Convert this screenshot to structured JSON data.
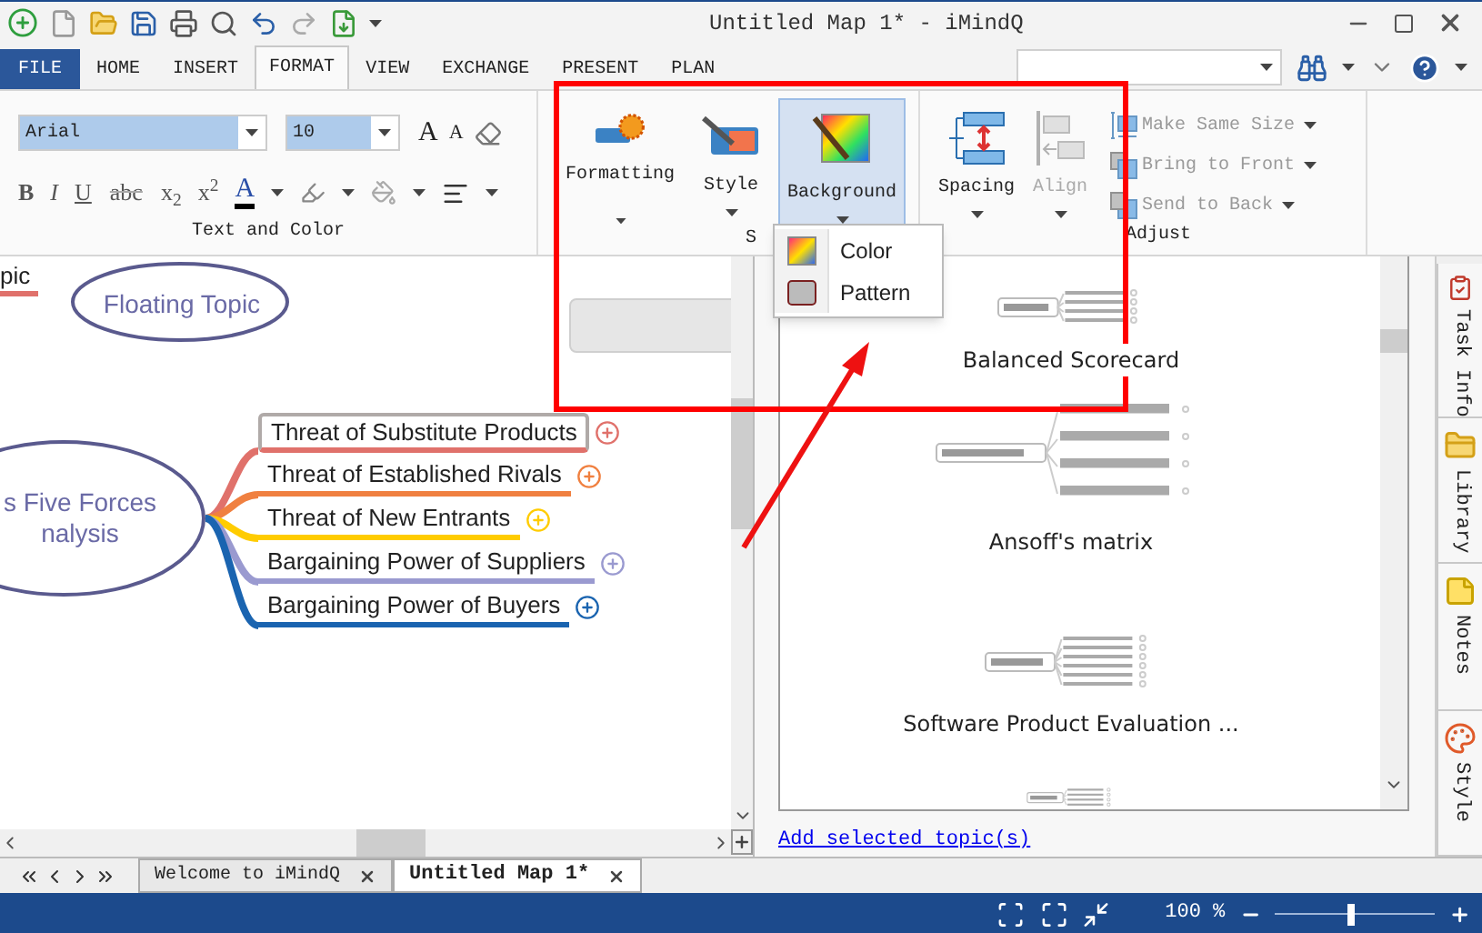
{
  "window": {
    "title": "Untitled Map 1* - iMindQ"
  },
  "ribbon_tabs": [
    {
      "label": "FILE",
      "kind": "file",
      "selected": false
    },
    {
      "label": "HOME",
      "kind": "tab",
      "selected": false
    },
    {
      "label": "INSERT",
      "kind": "tab",
      "selected": false
    },
    {
      "label": "FORMAT",
      "kind": "tab",
      "selected": true
    },
    {
      "label": "VIEW",
      "kind": "tab",
      "selected": false
    },
    {
      "label": "EXCHANGE",
      "kind": "tab",
      "selected": false
    },
    {
      "label": "PRESENT",
      "kind": "tab",
      "selected": false
    },
    {
      "label": "PLAN",
      "kind": "tab",
      "selected": false
    }
  ],
  "text_and_color": {
    "font": {
      "value": "Arial"
    },
    "size": {
      "value": "10"
    },
    "size_buttons": [
      {
        "label": "A",
        "kind": "grow"
      },
      {
        "label": "A",
        "kind": "shrink"
      }
    ],
    "format_buttons": [
      "B",
      "I",
      "U",
      "abc",
      "x$_{2}$",
      "x$^{2}$"
    ],
    "font_color": {
      "label": "A"
    },
    "label": "Text and Color"
  },
  "style_group": {
    "buttons": [
      {
        "label": "Formatting",
        "kind": "formatting",
        "selected": false
      },
      {
        "label": "Style",
        "kind": "style",
        "selected": false
      },
      {
        "label": "Background",
        "kind": "background",
        "selected": true
      }
    ],
    "label": "S"
  },
  "adjust_group": {
    "large_buttons": [
      {
        "label": "Spacing",
        "kind": "spacing",
        "disabled": false
      },
      {
        "label": "Align",
        "kind": "align",
        "disabled": true
      }
    ],
    "small_buttons": [
      {
        "label": "Make Same Size",
        "kind": "same-size",
        "disabled": true
      },
      {
        "label": "Bring to Front",
        "kind": "front",
        "disabled": true
      },
      {
        "label": "Send to Back",
        "kind": "back",
        "disabled": true
      }
    ],
    "label": "Adjust"
  },
  "background_menu": [
    {
      "label": "Color",
      "kind": "color"
    },
    {
      "label": "Pattern",
      "kind": "pattern"
    }
  ],
  "map": {
    "partial_topic": "pic",
    "floating_topic": "Floating Topic",
    "central_topic": "s Five Forces\nnalysis",
    "branches": [
      {
        "label": "Threat of Substitute Products",
        "color": "#e0716b",
        "selected": true
      },
      {
        "label": "Threat of Established Rivals",
        "color": "#f08040",
        "selected": false
      },
      {
        "label": "Threat of New Entrants",
        "color": "#ffcc00",
        "selected": false
      },
      {
        "label": "Bargaining Power of Suppliers",
        "color": "#9a9ad0",
        "selected": false
      },
      {
        "label": "Bargaining Power of Buyers",
        "color": "#1a64b0",
        "selected": false
      }
    ]
  },
  "templates": [
    {
      "title": "Balanced Scorecard"
    },
    {
      "title": "Ansoff's matrix"
    },
    {
      "title": "Software Product Evaluation ..."
    }
  ],
  "add_link": "Add selected topic(s)",
  "side_tabs": [
    {
      "label": "Task Info",
      "kind": "task"
    },
    {
      "label": "Library",
      "kind": "library"
    },
    {
      "label": "Notes",
      "kind": "notes"
    },
    {
      "label": "Style",
      "kind": "style"
    }
  ],
  "document_tabs": [
    {
      "label": "Welcome to iMindQ",
      "selected": false
    },
    {
      "label": "Untitled Map 1*",
      "selected": true
    }
  ],
  "status_bar": {
    "zoom": "100 %",
    "zoom_slider": {
      "level": 0.5
    }
  }
}
